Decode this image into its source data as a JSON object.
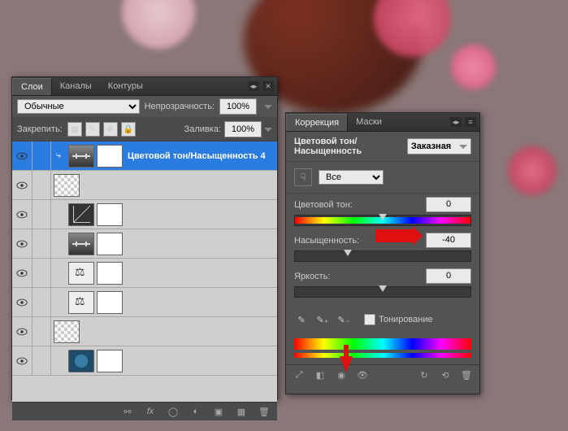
{
  "layers_panel": {
    "tabs": [
      "Слои",
      "Каналы",
      "Контуры"
    ],
    "blend_mode": "Обычные",
    "opacity_label": "Непрозрачность:",
    "opacity_value": "100%",
    "lock_label": "Закрепить:",
    "fill_label": "Заливка:",
    "fill_value": "100%",
    "layers": [
      {
        "name": "Цветовой тон/Насыщенность 4",
        "type": "huesat",
        "selected": true,
        "indent": 1
      },
      {
        "name": "Слой 18 копия 3",
        "type": "raster",
        "underline": true,
        "indent": 0
      },
      {
        "name": "Кривые 4",
        "type": "curves",
        "indent": 1
      },
      {
        "name": "Цветовой тон/Насыщенность 3",
        "type": "huesat",
        "indent": 1
      },
      {
        "name": "Цветовой баланс 2",
        "type": "balance",
        "indent": 1
      },
      {
        "name": "Цветовой баланс 1",
        "type": "balance",
        "indent": 1
      },
      {
        "name": "Слой 16",
        "type": "raster",
        "indent": 0
      },
      {
        "name": "Фотофильтр 1",
        "type": "photofilter",
        "indent": 1
      }
    ]
  },
  "adjustments_panel": {
    "tabs": [
      "Коррекция",
      "Маски"
    ],
    "title": "Цветовой тон/Насыщенность",
    "preset": "Заказная",
    "channel": "Все",
    "hue_label": "Цветовой тон:",
    "hue_value": "0",
    "sat_label": "Насыщенность:",
    "sat_value": "-40",
    "light_label": "Яркость:",
    "light_value": "0",
    "colorize_label": "Тонирование"
  }
}
